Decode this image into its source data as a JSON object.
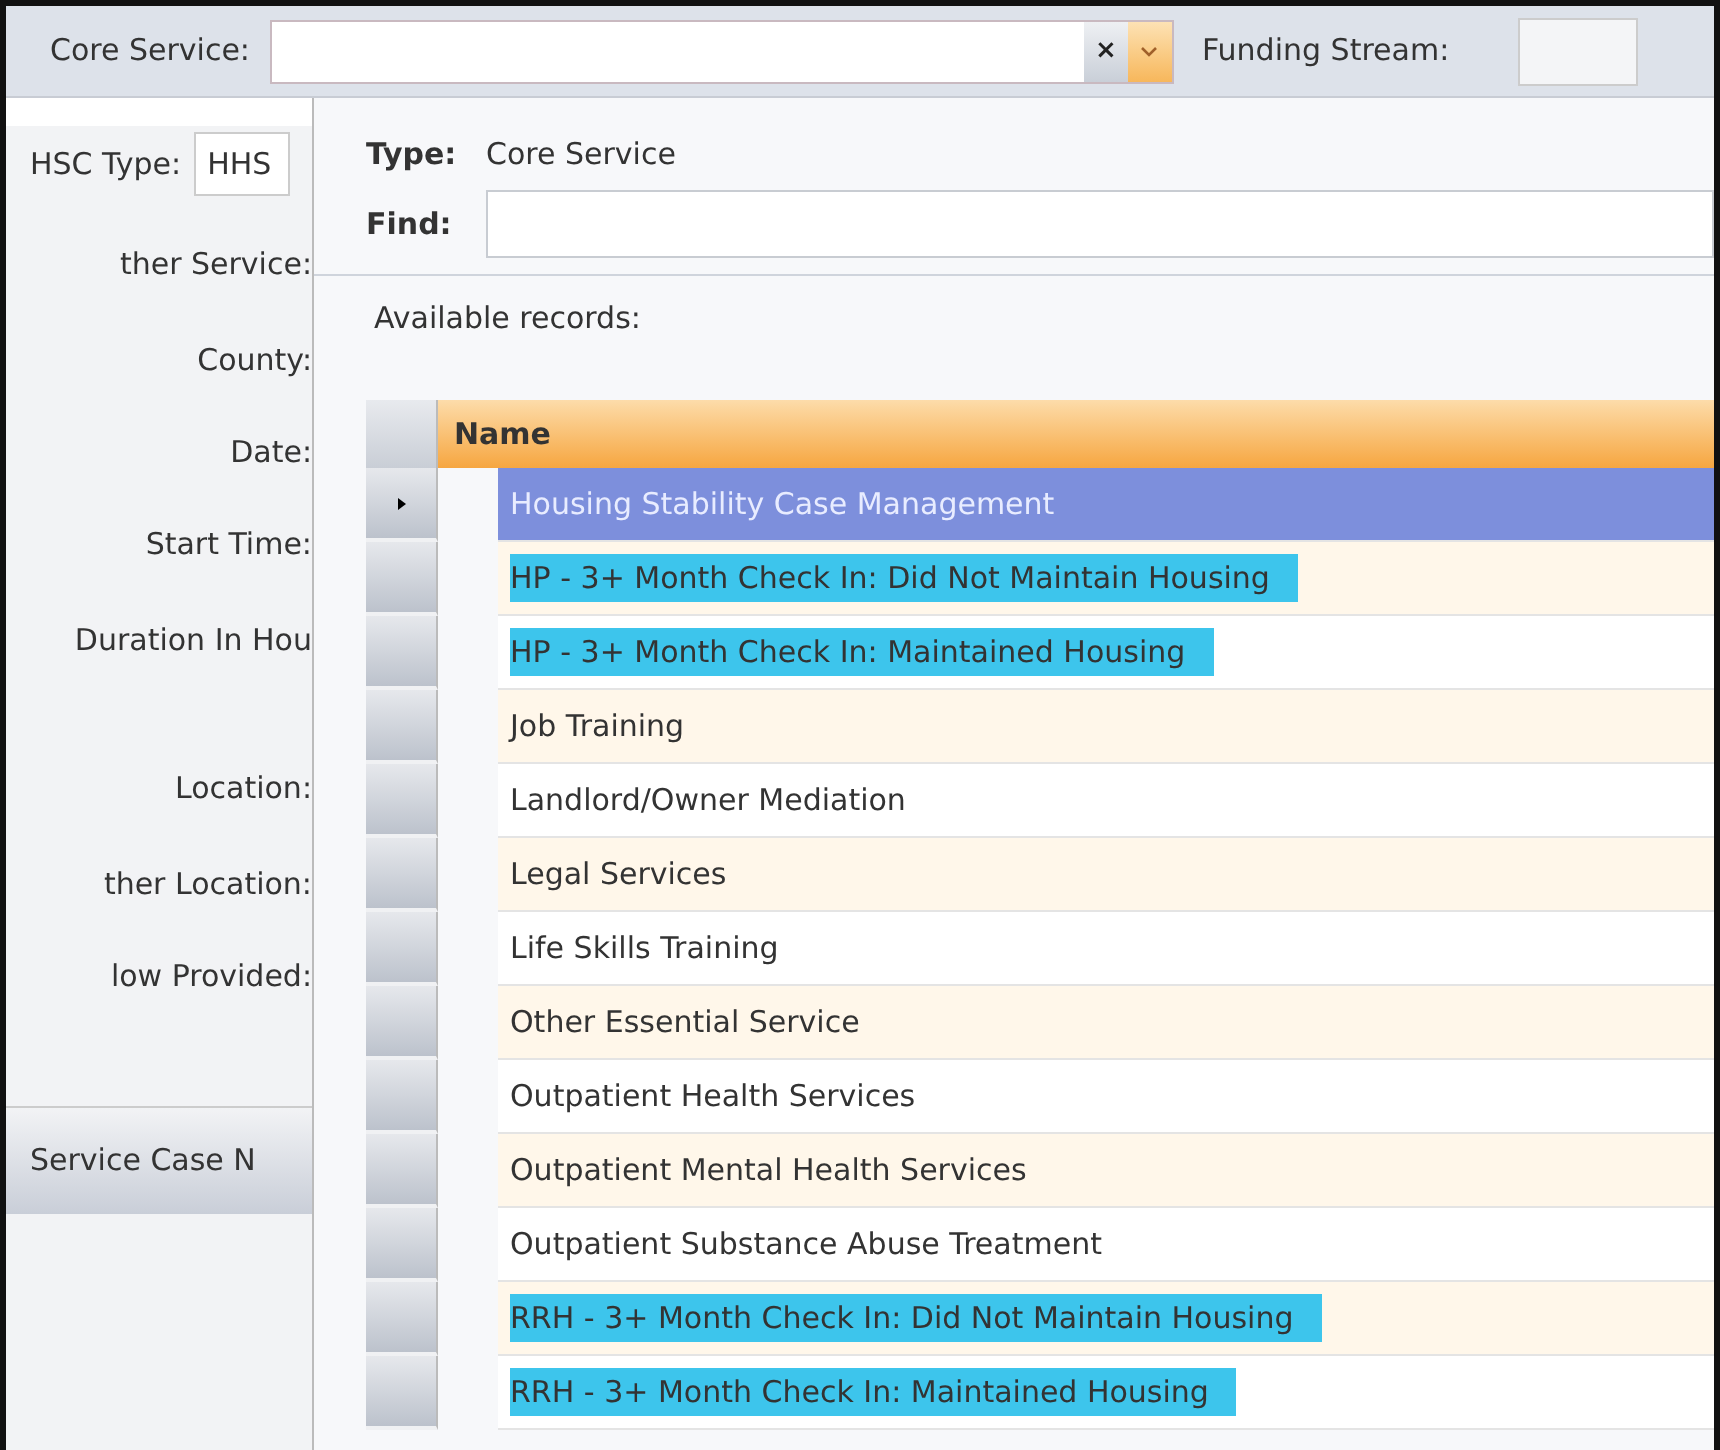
{
  "top_bar": {
    "core_service_label": "Core Service:",
    "clear_button": "×",
    "funding_stream_label": "Funding Stream:"
  },
  "left_form": {
    "fields": [
      {
        "label": "HSC Type:",
        "value": "HHS"
      },
      {
        "label": "ther Service:"
      },
      {
        "label": "County:"
      },
      {
        "label": "Date:"
      },
      {
        "label": "Start Time:"
      },
      {
        "label": "Duration In Hou"
      },
      {
        "label": "Location:"
      },
      {
        "label": "ther Location:"
      },
      {
        "label": "low Provided:"
      }
    ],
    "tab": "Service Case N"
  },
  "popup": {
    "type_label": "Type:",
    "type_value": "Core Service",
    "find_label": "Find:",
    "available_label": "Available records:",
    "column": "Name",
    "rows": [
      {
        "name": "Housing Stability Case Management",
        "selected": true,
        "highlighted": false
      },
      {
        "name": "HP - 3+ Month Check In: Did Not Maintain Housing",
        "selected": false,
        "highlighted": true
      },
      {
        "name": "HP - 3+ Month Check In: Maintained Housing",
        "selected": false,
        "highlighted": true
      },
      {
        "name": "Job Training",
        "selected": false,
        "highlighted": false
      },
      {
        "name": "Landlord/Owner Mediation",
        "selected": false,
        "highlighted": false
      },
      {
        "name": "Legal Services",
        "selected": false,
        "highlighted": false
      },
      {
        "name": "Life Skills Training",
        "selected": false,
        "highlighted": false
      },
      {
        "name": "Other Essential Service",
        "selected": false,
        "highlighted": false
      },
      {
        "name": "Outpatient Health Services",
        "selected": false,
        "highlighted": false
      },
      {
        "name": "Outpatient Mental Health Services",
        "selected": false,
        "highlighted": false
      },
      {
        "name": "Outpatient Substance Abuse Treatment",
        "selected": false,
        "highlighted": false
      },
      {
        "name": "RRH - 3+ Month Check In: Did Not Maintain Housing",
        "selected": false,
        "highlighted": true
      },
      {
        "name": "RRH - 3+ Month Check In: Maintained Housing",
        "selected": false,
        "highlighted": true
      }
    ]
  }
}
